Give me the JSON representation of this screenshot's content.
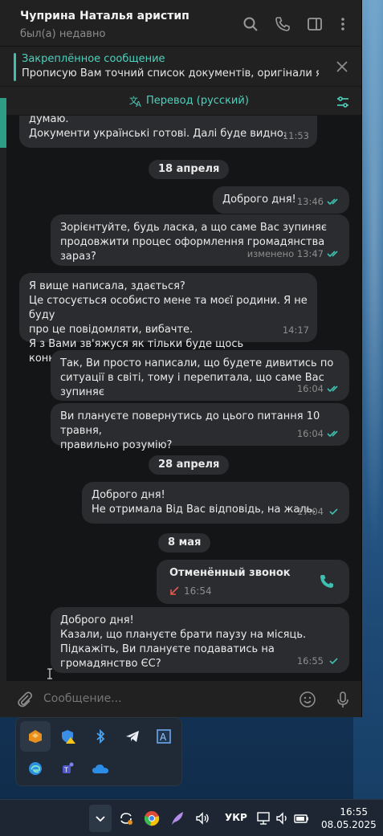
{
  "header": {
    "name": "Чуприна Наталья аристип",
    "status": "был(а) недавно"
  },
  "pinned": {
    "title": "Закреплённое сообщение",
    "text": "Прописую Вам точний список документів, оригінали які..."
  },
  "translate": {
    "label": "Перевод (русский)"
  },
  "messages": [
    {
      "side": "in",
      "text": "думаю.\nДокументи українські готові. Далі буде видно.",
      "time": "11:53"
    },
    {
      "side": "date",
      "text": "18 апреля"
    },
    {
      "side": "out",
      "text": "Доброго дня!",
      "time": "13:46",
      "read": true
    },
    {
      "side": "out",
      "text": "Зорієнтуйте, будь ласка, а що саме Вас зупиняє\nпродовжити процес оформлення громадянства зараз?",
      "time": "изменено 13:47",
      "read": true
    },
    {
      "side": "in",
      "text": "Я вище написала, здається?\nЦе стосується особисто мене та моєї родини. Я не буду\nпро це повідомляти, вибачте.\nЯ з Вами зв'яжуся як тільки буде щось конкретне.",
      "time": "14:17"
    },
    {
      "side": "out",
      "text": "Так, Ви просто написали, що будете дивитись по\nситуації в світі, тому і перепитала, що саме Вас зупиняє",
      "time": "16:04",
      "read": true
    },
    {
      "side": "out",
      "text": "Ви плануєте повернутись до цього питання 10 травня,\nправильно розумію?",
      "time": "16:04",
      "read": true
    },
    {
      "side": "date",
      "text": "28 апреля"
    },
    {
      "side": "out",
      "text": "Доброго дня!\nНе отримала Від Вас відповідь, на жаль.",
      "time": "17:04",
      "read": false
    },
    {
      "side": "date",
      "text": "8 мая"
    },
    {
      "side": "call",
      "title": "Отменённый звонок",
      "time": "16:54"
    },
    {
      "side": "out",
      "text": "Доброго дня!\nКазали, що плануєте брати паузу на місяць.\nПідкажіть, Ви плануєте подаватись на громадянство ЄС?",
      "time": "16:55",
      "read": false
    }
  ],
  "input": {
    "placeholder": "Сообщение..."
  },
  "tray_icons": [
    "fortinet-icon",
    "defender-warning-icon",
    "bluetooth-icon",
    "telegram-icon",
    "translate-icon",
    "edge-icon",
    "teams-icon",
    "onedrive-icon"
  ],
  "taskbar": {
    "lang": "УКР",
    "time": "16:55",
    "date": "08.05.2025"
  },
  "colors": {
    "accent": "#4fd1bd",
    "check": "#3fbfb0",
    "bubble": "#2b2c2f",
    "chat_bg": "#141517"
  }
}
